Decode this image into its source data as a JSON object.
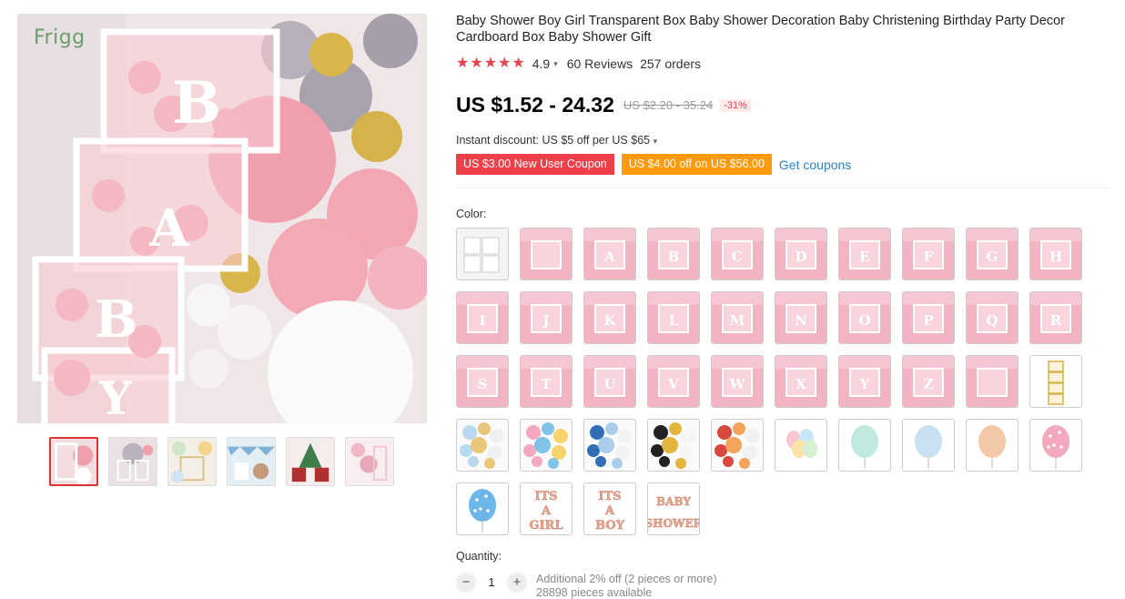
{
  "brand": {
    "logo_text": "Frigg"
  },
  "product": {
    "title": "Baby Shower Boy Girl Transparent Box Baby Shower Decoration Baby Christening Birthday Party Decor Cardboard Box Baby Shower Gift",
    "rating": "4.9",
    "rating_stars": 5,
    "reviews": "60 Reviews",
    "orders": "257 orders"
  },
  "pricing": {
    "price": "US $1.52 - 24.32",
    "old_price": "US $2.20 - 35.24",
    "discount": "-31%",
    "instant_discount": "Instant discount: US $5 off per US $65"
  },
  "coupons": {
    "new_user": "US $3.00 New User Coupon",
    "store": "US $4.00 off on US $56.00",
    "get_link": "Get coupons"
  },
  "colors": {
    "accent_red": "#ef4049",
    "accent_orange": "#ff9a0e",
    "link_blue": "#2b84c8",
    "star_red": "#e8434f"
  },
  "variants": {
    "label": "Color:",
    "items": [
      {
        "kind": "box-white",
        "letter": "BABY"
      },
      {
        "kind": "box-pink",
        "letter": ""
      },
      {
        "kind": "box-pink",
        "letter": "A"
      },
      {
        "kind": "box-pink",
        "letter": "B"
      },
      {
        "kind": "box-pink",
        "letter": "C"
      },
      {
        "kind": "box-pink",
        "letter": "D"
      },
      {
        "kind": "box-pink",
        "letter": "E"
      },
      {
        "kind": "box-pink",
        "letter": "F"
      },
      {
        "kind": "box-pink",
        "letter": "G"
      },
      {
        "kind": "box-pink",
        "letter": "H"
      },
      {
        "kind": "box-pink",
        "letter": "I"
      },
      {
        "kind": "box-pink",
        "letter": "J"
      },
      {
        "kind": "box-pink",
        "letter": "K"
      },
      {
        "kind": "box-pink",
        "letter": "L"
      },
      {
        "kind": "box-pink",
        "letter": "M"
      },
      {
        "kind": "box-pink",
        "letter": "N"
      },
      {
        "kind": "box-pink",
        "letter": "O"
      },
      {
        "kind": "box-pink",
        "letter": "P"
      },
      {
        "kind": "box-pink",
        "letter": "Q"
      },
      {
        "kind": "box-pink",
        "letter": "R"
      },
      {
        "kind": "box-pink",
        "letter": "S"
      },
      {
        "kind": "box-pink",
        "letter": "T"
      },
      {
        "kind": "box-pink",
        "letter": "U"
      },
      {
        "kind": "box-pink",
        "letter": "V"
      },
      {
        "kind": "box-pink",
        "letter": "W"
      },
      {
        "kind": "box-pink",
        "letter": "X"
      },
      {
        "kind": "box-pink",
        "letter": "Y"
      },
      {
        "kind": "box-pink",
        "letter": "Z"
      },
      {
        "kind": "box-pink",
        "letter": ""
      },
      {
        "kind": "box-gold",
        "letter": ""
      },
      {
        "kind": "kit-blue",
        "letter": ""
      },
      {
        "kind": "kit-pink",
        "letter": ""
      },
      {
        "kind": "kit-navy",
        "letter": ""
      },
      {
        "kind": "kit-black",
        "letter": ""
      },
      {
        "kind": "kit-red",
        "letter": ""
      },
      {
        "kind": "balloon-pastel",
        "letter": ""
      },
      {
        "kind": "balloon-mint",
        "letter": ""
      },
      {
        "kind": "balloon-blue",
        "letter": ""
      },
      {
        "kind": "balloon-peach",
        "letter": ""
      },
      {
        "kind": "balloon-confetti-pink",
        "letter": ""
      },
      {
        "kind": "balloon-confetti-blue",
        "letter": ""
      },
      {
        "kind": "text-its-a-girl",
        "letter": "ITS A GIRL"
      },
      {
        "kind": "text-its-a-boy",
        "letter": "ITS A BOY"
      },
      {
        "kind": "text-baby-shower",
        "letter": "BABY SHOWER"
      }
    ]
  },
  "quantity": {
    "label": "Quantity:",
    "value": "1",
    "minus": "−",
    "plus": "+",
    "note": "Additional 2% off (2 pieces or more)",
    "available": "28898 pieces available"
  }
}
